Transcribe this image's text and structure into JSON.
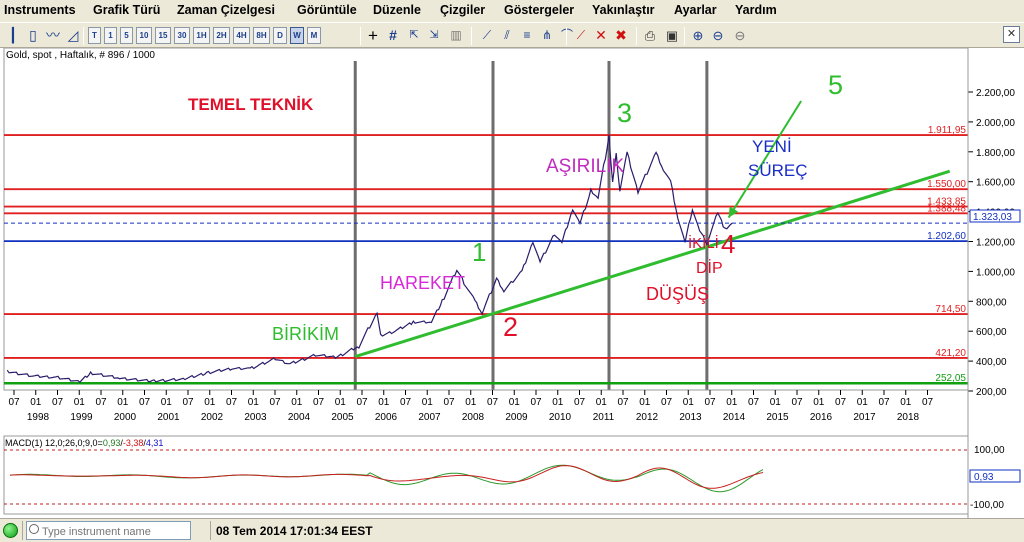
{
  "menu": [
    "Instruments",
    "Grafik Türü",
    "Zaman Çizelgesi",
    "Görüntüle",
    "Düzenle",
    "Çizgiler",
    "Göstergeler",
    "Yakınlaştır",
    "Ayarlar",
    "Yardım"
  ],
  "toolbar": {
    "timeframes": [
      "T",
      "1",
      "5",
      "10",
      "15",
      "30",
      "1H",
      "2H",
      "4H",
      "8H",
      "D",
      "W",
      "M"
    ],
    "active_timeframe": "W",
    "close_icon": "close-icon"
  },
  "chart": {
    "header": "Gold, spot , Haftalık, # 896 / 1000",
    "annotation_title": "TEMEL TEKNİK",
    "annotations": {
      "birikim": "BİRİKİM",
      "hareket": "HAREKET",
      "asirilik": "AŞIRILIK",
      "yeni": "YENİ",
      "surec": "SÜREÇ",
      "ikili": "İKİLİ",
      "dip": "DİP",
      "dusus": "DÜŞÜŞ",
      "n1": "1",
      "n2": "2",
      "n3": "3",
      "n4": "4",
      "n5": "5"
    },
    "price_axis": [
      "2.200,00",
      "2.000,00",
      "1.800,00",
      "1.600,00",
      "1.400,00",
      "1.200,00",
      "1.000,00",
      "800,00",
      "600,00",
      "400,00",
      "200,00"
    ],
    "price_axis_values": [
      2200,
      2000,
      1800,
      1600,
      1400,
      1200,
      1000,
      800,
      600,
      400,
      200
    ],
    "levels": [
      {
        "label": "1.911,95",
        "value": 1911.95,
        "color": "#e02020"
      },
      {
        "label": "1.550,00",
        "value": 1550,
        "color": "#e02020"
      },
      {
        "label": "1.433,85",
        "value": 1433.85,
        "color": "#e02020"
      },
      {
        "label": "1.388,48",
        "value": 1388.48,
        "color": "#e02020"
      },
      {
        "label": "1.202,60",
        "value": 1202.6,
        "color": "#1030c0"
      },
      {
        "label": "714,50",
        "value": 714.5,
        "color": "#e02020"
      },
      {
        "label": "421,20",
        "value": 421.2,
        "color": "#e02020"
      },
      {
        "label": "252,05",
        "value": 252.05,
        "color": "#10a010"
      }
    ],
    "current_price": "1.323,03",
    "current_value": 1323.03,
    "month_ticks": [
      "07",
      "01",
      "07",
      "01",
      "07",
      "01",
      "07",
      "01",
      "07",
      "01",
      "07",
      "01",
      "07",
      "01",
      "07",
      "01",
      "07",
      "01",
      "07",
      "01",
      "07",
      "01",
      "07",
      "01",
      "07",
      "01",
      "07",
      "01",
      "07",
      "01",
      "07",
      "01",
      "07",
      "01",
      "07",
      "01",
      "07",
      "01",
      "07",
      "01",
      "07",
      "01",
      "07"
    ],
    "years": [
      "1998",
      "1999",
      "2000",
      "2001",
      "2002",
      "2003",
      "2004",
      "2005",
      "2006",
      "2007",
      "2008",
      "2009",
      "2010",
      "2011",
      "2012",
      "2013",
      "2014",
      "2015",
      "2016",
      "2017",
      "2018"
    ],
    "price_path": [
      [
        "1997-11",
        330
      ],
      [
        "1998-06",
        300
      ],
      [
        "1999-01",
        290
      ],
      [
        "1999-07",
        260
      ],
      [
        "1999-10",
        320
      ],
      [
        "2000-06",
        285
      ],
      [
        "2001-03",
        265
      ],
      [
        "2001-12",
        280
      ],
      [
        "2002-06",
        320
      ],
      [
        "2003-01",
        350
      ],
      [
        "2003-06",
        350
      ],
      [
        "2004-01",
        415
      ],
      [
        "2004-05",
        380
      ],
      [
        "2004-12",
        440
      ],
      [
        "2005-06",
        425
      ],
      [
        "2005-12",
        500
      ],
      [
        "2006-05",
        720
      ],
      [
        "2006-06",
        570
      ],
      [
        "2006-10",
        600
      ],
      [
        "2007-03",
        660
      ],
      [
        "2007-08",
        660
      ],
      [
        "2007-11",
        800
      ],
      [
        "2008-03",
        1010
      ],
      [
        "2008-08",
        800
      ],
      [
        "2008-10",
        720
      ],
      [
        "2009-02",
        950
      ],
      [
        "2009-04",
        870
      ],
      [
        "2009-09",
        1000
      ],
      [
        "2009-12",
        1200
      ],
      [
        "2010-02",
        1060
      ],
      [
        "2010-06",
        1250
      ],
      [
        "2010-08",
        1190
      ],
      [
        "2010-11",
        1420
      ],
      [
        "2011-01",
        1320
      ],
      [
        "2011-04",
        1540
      ],
      [
        "2011-06",
        1490
      ],
      [
        "2011-09",
        1900
      ],
      [
        "2011-10",
        1600
      ],
      [
        "2011-11",
        1780
      ],
      [
        "2011-12",
        1540
      ],
      [
        "2012-02",
        1790
      ],
      [
        "2012-05",
        1530
      ],
      [
        "2012-10",
        1790
      ],
      [
        "2012-12",
        1680
      ],
      [
        "2013-02",
        1600
      ],
      [
        "2013-04",
        1360
      ],
      [
        "2013-06",
        1190
      ],
      [
        "2013-08",
        1420
      ],
      [
        "2013-10",
        1270
      ],
      [
        "2013-12",
        1190
      ],
      [
        "2014-03",
        1390
      ],
      [
        "2014-05",
        1280
      ],
      [
        "2014-07",
        1323
      ]
    ],
    "trendline_a": {
      "from": [
        "2005-11",
        430
      ],
      "to": [
        "2019-07",
        1670
      ]
    },
    "trendline_b": {
      "from": [
        "2014-06",
        1360
      ],
      "to": [
        "2016-02",
        2140
      ]
    },
    "vertical_lines": [
      "2005-11",
      "2009-01",
      "2011-09",
      "2013-12"
    ]
  },
  "macd": {
    "label": "MACD(1) 12,0;26,0;9,0=",
    "value_main": "0,93",
    "value_signal": "-3,38",
    "value_hist": "4,31",
    "axis": [
      "100,00",
      "-100,00"
    ],
    "current": "0,93"
  },
  "status": {
    "search_placeholder": "Type instrument name",
    "datetime": "08 Tem 2014 17:01:34 EEST"
  }
}
